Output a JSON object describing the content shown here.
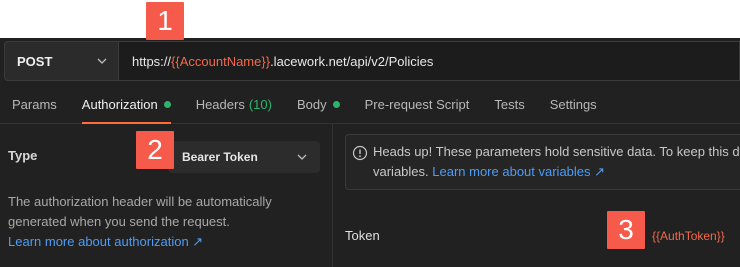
{
  "request": {
    "method": "POST",
    "url_prefix": "https://",
    "url_variable": "{{AccountName}}",
    "url_suffix": ".lacework.net/api/v2/Policies"
  },
  "tabs": [
    {
      "label": "Params"
    },
    {
      "label": "Authorization"
    },
    {
      "label": "Headers",
      "count": "(10)"
    },
    {
      "label": "Body"
    },
    {
      "label": "Pre-request Script"
    },
    {
      "label": "Tests"
    },
    {
      "label": "Settings"
    }
  ],
  "auth": {
    "type_label": "Type",
    "type_value": "Bearer Token",
    "description": "The authorization header will be automatically generated when you send the request.",
    "learn_more": "Learn more about authorization ↗"
  },
  "notice": {
    "text": "Heads up! These parameters hold sensitive data. To keep this da",
    "text_line2": "variables.",
    "link": "Learn more about variables ↗"
  },
  "token": {
    "label": "Token",
    "value": "{{AuthToken}}"
  },
  "markers": [
    "1",
    "2",
    "3"
  ],
  "colors": {
    "accent": "#ff6c37",
    "variable": "#f2694b",
    "status_dot": "#2fb36b",
    "link": "#4d9cf5",
    "marker": "#f65a4b"
  }
}
